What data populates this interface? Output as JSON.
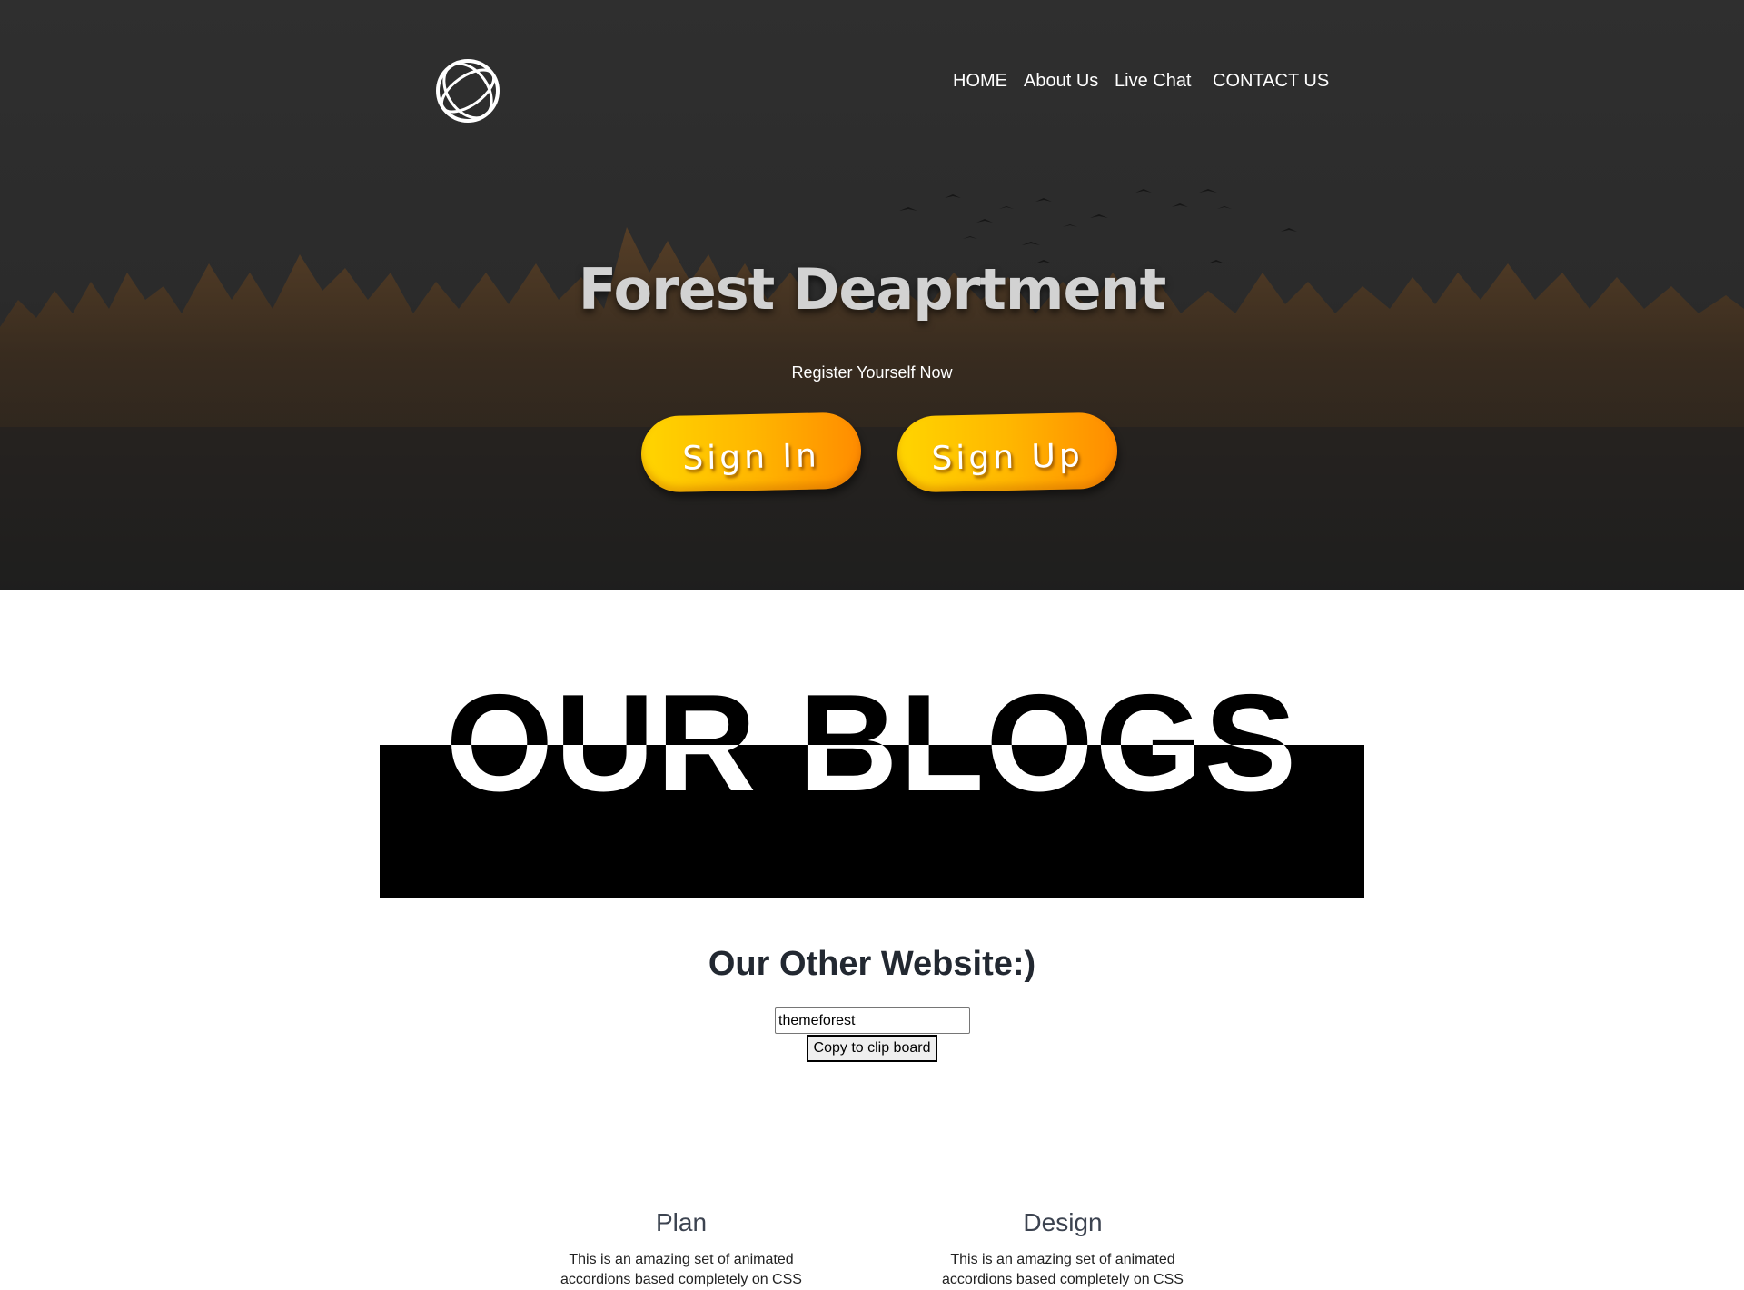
{
  "header": {
    "logo_icon": "globe-logo-icon",
    "nav": [
      {
        "label": "HOME"
      },
      {
        "label": "About Us"
      },
      {
        "label": "Live Chat"
      },
      {
        "label": "CONTACT US"
      }
    ]
  },
  "hero": {
    "title": "Forest Deaprtment",
    "subtitle": "Register Yourself Now",
    "signin_label": "Sign In",
    "signup_label": "Sign Up",
    "button_colors": [
      "#ffd500",
      "#ff8c00"
    ]
  },
  "blogs": {
    "title": "OUR BLOGS"
  },
  "other_site": {
    "title": "Our Other Website:)",
    "input_value": "themeforest",
    "copy_label": "Copy to clip board"
  },
  "cards": [
    {
      "title": "Plan",
      "text": "This is an amazing set of animated accordions based completely on CSS"
    },
    {
      "title": "Design",
      "text": "This is an amazing set of animated accordions based completely on CSS"
    }
  ]
}
